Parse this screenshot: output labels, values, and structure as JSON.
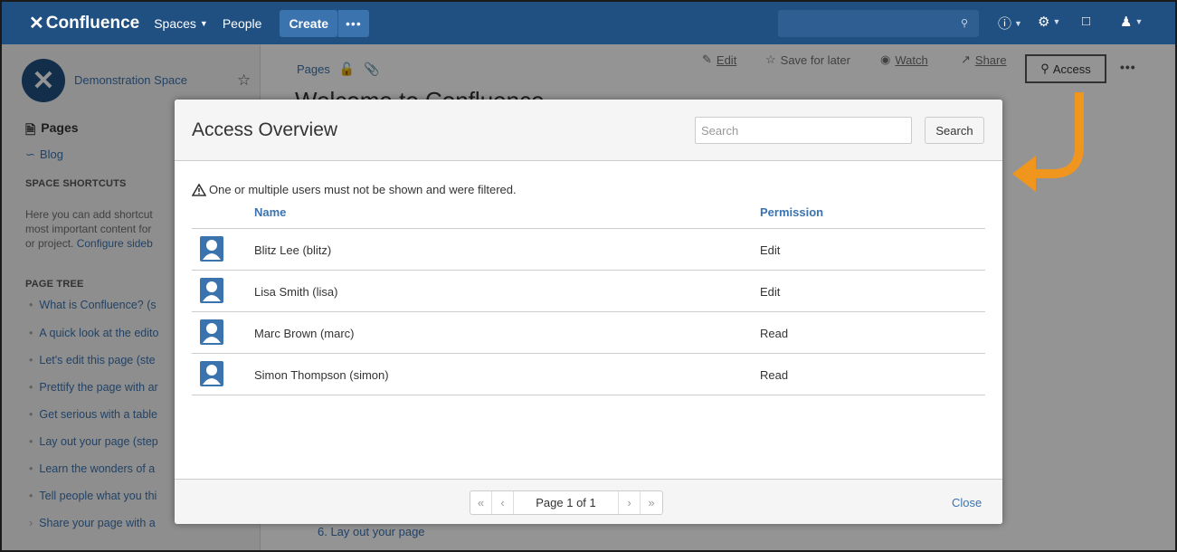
{
  "topnav": {
    "logo": "Confluence",
    "spaces": "Spaces",
    "people": "People",
    "create": "Create",
    "more": "•••"
  },
  "sidebar": {
    "space_name": "Demonstration Space",
    "pages": "Pages",
    "blog": "Blog",
    "shortcuts_heading": "SPACE SHORTCUTS",
    "shortcuts_text": "Here you can add shortcut",
    "shortcuts_text2": "most important content for",
    "shortcuts_text3": "or project.",
    "configure_link": "Configure sideb",
    "tree_heading": "PAGE TREE",
    "tree": [
      "What is Confluence? (s",
      "A quick look at the edito",
      "Let's edit this page (ste",
      "Prettify the page with ar",
      "Get serious with a table",
      "Lay out your page (step",
      "Learn the wonders of a",
      "Tell people what you thi",
      "Share your page with a"
    ]
  },
  "page": {
    "breadcrumb": "Pages",
    "title": "Welcome to Confluence",
    "actions": {
      "edit": "Edit",
      "save_for_later": "Save for later",
      "watch": "Watch",
      "share": "Share",
      "access": "Access"
    },
    "list_item": "6. Lay out your page"
  },
  "dialog": {
    "title": "Access Overview",
    "search_placeholder": "Search",
    "search_button": "Search",
    "warning": "One or multiple users must not be shown and were filtered.",
    "col_name": "Name",
    "col_permission": "Permission",
    "rows": [
      {
        "name": "Blitz Lee (blitz)",
        "permission": "Edit"
      },
      {
        "name": "Lisa Smith (lisa)",
        "permission": "Edit"
      },
      {
        "name": "Marc Brown (marc)",
        "permission": "Read"
      },
      {
        "name": "Simon Thompson (simon)",
        "permission": "Read"
      }
    ],
    "pager": {
      "first": "«",
      "prev": "‹",
      "label": "Page 1 of 1",
      "next": "›",
      "last": "»"
    },
    "close": "Close"
  },
  "colors": {
    "nav": "#205081",
    "link": "#3b73af",
    "arrow": "#f0961e"
  }
}
